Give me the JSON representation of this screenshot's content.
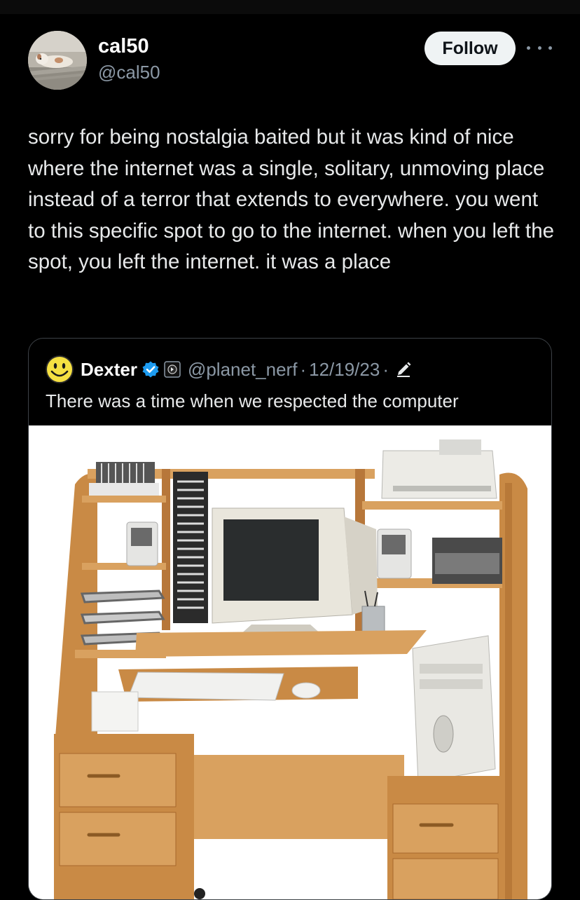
{
  "author": {
    "display_name": "cal50",
    "handle": "@cal50",
    "avatar": "avatar-photo-dog-lying"
  },
  "actions": {
    "follow_label": "Follow",
    "more_icon": "more-horizontal-icon"
  },
  "post": {
    "text": "sorry for being nostalgia baited but it was kind of nice where the internet was a single, solitary, unmoving place instead of a terror that extends to everywhere. you went to this specific spot to go to the internet.  when you left the spot, you left the internet. it was a place"
  },
  "quoted_post": {
    "display_name": "Dexter",
    "verified_icon": "verified-badge-icon",
    "affiliate_icon": "affiliate-badge-icon",
    "handle": "@planet_nerf",
    "separator": "·",
    "date": "12/19/23",
    "edited_icon": "edit-pencil-icon",
    "text": "There was a time when we respected the computer",
    "media": "photo-wooden-computer-desk-with-crt-monitor"
  },
  "colors": {
    "background": "#000000",
    "text_primary": "#e7e9ea",
    "text_secondary": "#8b98a5",
    "verified_blue": "#1d9bf0",
    "follow_button_bg": "#eff3f4",
    "card_border": "#3d4247"
  }
}
